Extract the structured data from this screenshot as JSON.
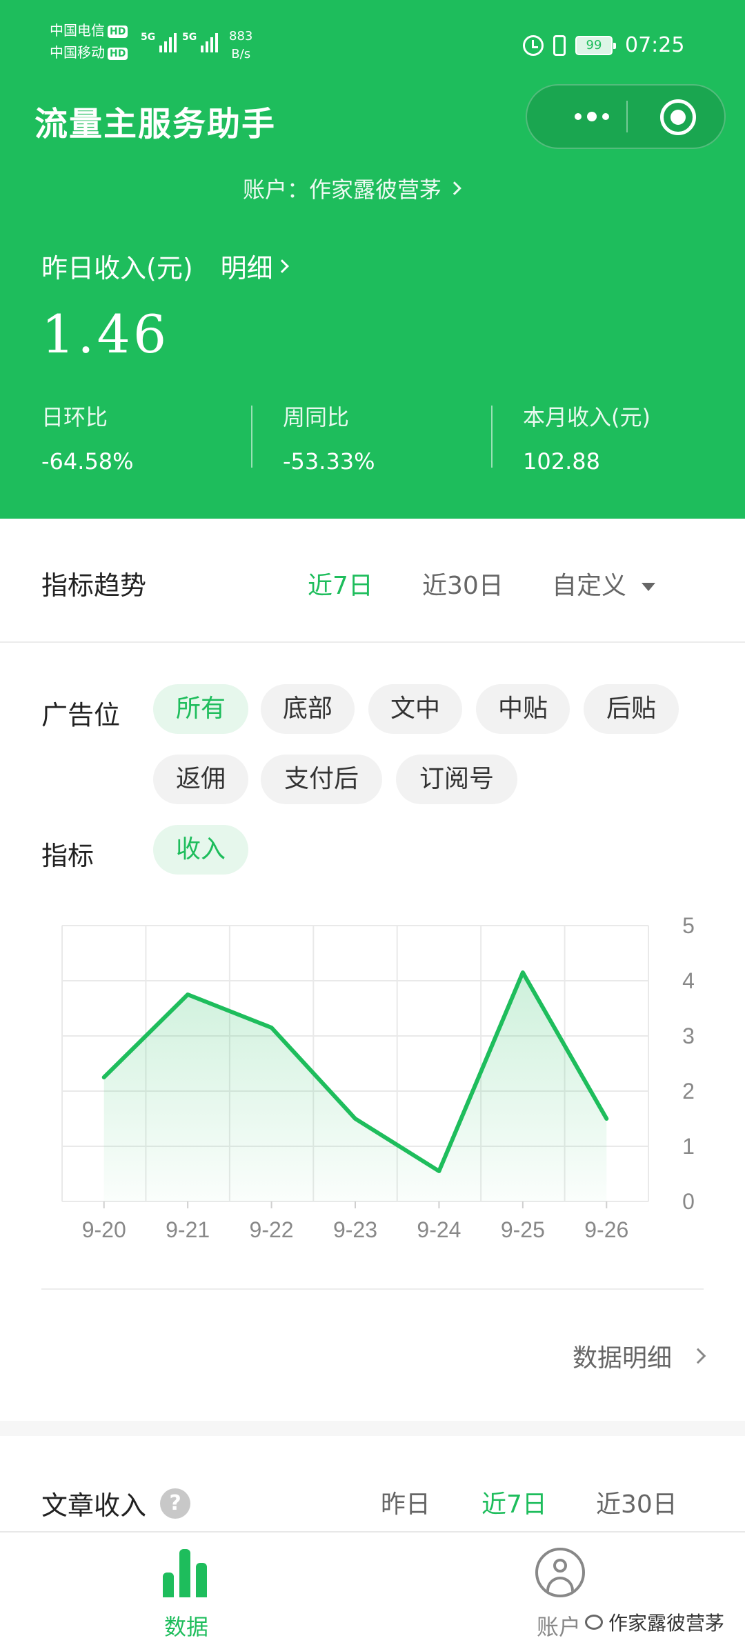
{
  "status_bar": {
    "carrier1": "中国电信",
    "carrier2": "中国移动",
    "hd": "HD",
    "network": "5G",
    "speed_value": "883",
    "speed_unit": "B/s",
    "battery": "99",
    "time": "07:25"
  },
  "header": {
    "title": "流量主服务助手",
    "account_label": "账户：作家露彼营茅"
  },
  "summary": {
    "yesterday_label": "昨日收入(元)",
    "detail_link": "明细",
    "yesterday_value": "1.46",
    "stats": [
      {
        "label": "日环比",
        "value": "-64.58%"
      },
      {
        "label": "周同比",
        "value": "-53.33%"
      },
      {
        "label": "本月收入(元)",
        "value": "102.88"
      }
    ]
  },
  "trend": {
    "title": "指标趋势",
    "ranges": [
      "近7日",
      "近30日",
      "自定义"
    ],
    "active_range": "近7日",
    "ad_slot_label": "广告位",
    "ad_slots": [
      "所有",
      "底部",
      "文中",
      "中贴",
      "后贴",
      "返佣",
      "支付后",
      "订阅号"
    ],
    "metric_label": "指标",
    "metrics": [
      "收入"
    ],
    "data_detail_link": "数据明细"
  },
  "chart_data": {
    "type": "area",
    "categories": [
      "9-20",
      "9-21",
      "9-22",
      "9-23",
      "9-24",
      "9-25",
      "9-26"
    ],
    "series": [
      {
        "values": [
          2.25,
          3.75,
          3.15,
          1.5,
          0.55,
          4.15,
          1.5
        ]
      }
    ],
    "y_ticks": [
      "0",
      "1",
      "2",
      "3",
      "4",
      "5"
    ],
    "ylim": [
      0,
      5
    ],
    "y_axis_side": "right",
    "grid": true,
    "line_color": "#1ebd5c"
  },
  "article_income": {
    "title": "文章收入",
    "help": "?",
    "ranges": [
      "昨日",
      "近7日",
      "近30日"
    ],
    "active_range": "近7日"
  },
  "bottom_nav": {
    "items": [
      {
        "label": "数据",
        "icon": "bar-chart-icon",
        "active": true
      },
      {
        "label": "账户",
        "icon": "user-icon",
        "active": false
      }
    ],
    "watermark": "作家露彼营茅"
  },
  "colors": {
    "brand_green": "#1ebd5c",
    "chip_bg": "#f2f2f2",
    "chip_active_bg": "#e6f7ec"
  }
}
